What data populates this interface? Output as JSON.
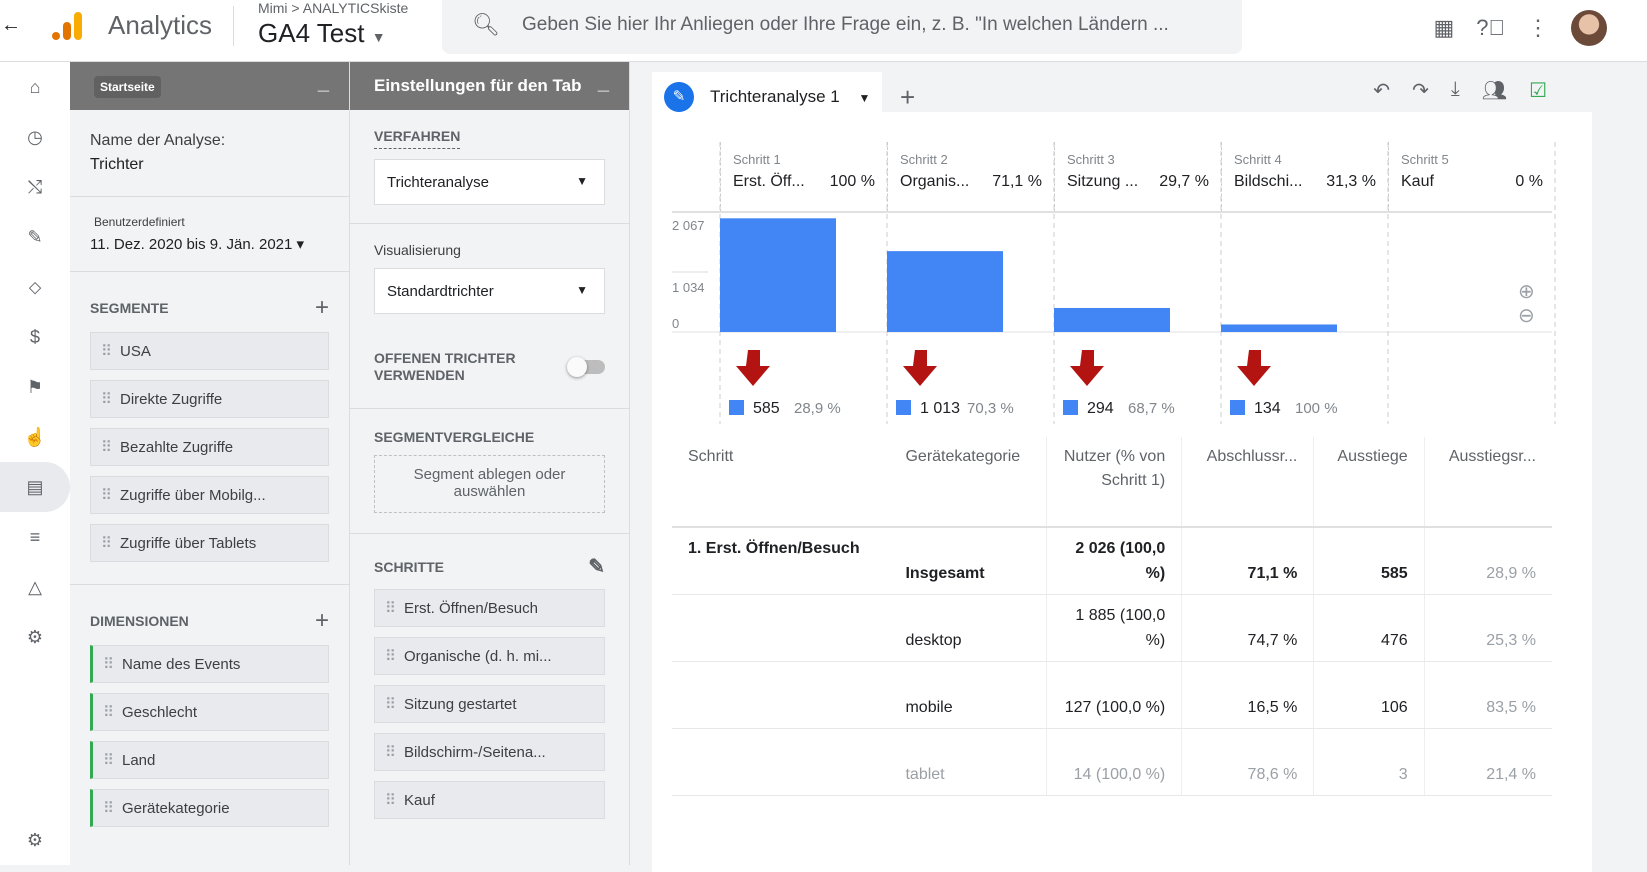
{
  "header": {
    "back": "←",
    "brand": "Analytics",
    "breadcrumb": "Mimi > ANALYTICSkiste",
    "property": "GA4 Test",
    "search_placeholder": "Geben Sie hier Ihr Anliegen oder Ihre Frage ein, z. B. \"In welchen Ländern ..."
  },
  "variables_panel": {
    "tooltip": "Startseite",
    "name_label": "Name der Analyse:",
    "name_value": "Trichter",
    "date_label": "Benutzerdefiniert",
    "date_range": "11. Dez. 2020 bis 9. Jän. 2021",
    "segments_label": "SEGMENTE",
    "segments": [
      "USA",
      "Direkte Zugriffe",
      "Bezahlte Zugriffe",
      "Zugriffe über Mobilg...",
      "Zugriffe über Tablets"
    ],
    "dimensions_label": "DIMENSIONEN",
    "dimensions": [
      "Name des Events",
      "Geschlecht",
      "Land",
      "Gerätekategorie"
    ]
  },
  "tab_settings": {
    "title": "Einstellungen für den Tab",
    "technique_label": "VERFAHREN",
    "technique": "Trichteranalyse",
    "viz_label": "Visualisierung",
    "viz": "Standardtrichter",
    "open_funnel_label": "OFFENEN TRICHTER VERWENDEN",
    "open_funnel": false,
    "segment_compare_label": "SEGMENTVERGLEICHE",
    "segment_drop": "Segment ablegen oder auswählen",
    "steps_label": "SCHRITTE",
    "steps": [
      "Erst. Öffnen/Besuch",
      "Organische (d. h. mi...",
      "Sitzung gestartet",
      "Bildschirm-/Seitena...",
      "Kauf"
    ]
  },
  "tab": {
    "label": "Trichteranalyse 1"
  },
  "chart_data": {
    "type": "bar",
    "y_ticks": [
      "2 067",
      "1 034",
      "0"
    ],
    "ylim": [
      0,
      2067
    ],
    "steps": [
      {
        "step": "Schritt 1",
        "name": "Erst. Öff...",
        "pct": "100 %",
        "value": 2026,
        "exits": "585",
        "exit_pct": "28,9 %"
      },
      {
        "step": "Schritt 2",
        "name": "Organis...",
        "pct": "71,1 %",
        "value": 1441,
        "exits": "1 013",
        "exit_pct": "70,3 %"
      },
      {
        "step": "Schritt 3",
        "name": "Sitzung ...",
        "pct": "29,7 %",
        "value": 428,
        "exits": "294",
        "exit_pct": "68,7 %"
      },
      {
        "step": "Schritt 4",
        "name": "Bildschi...",
        "pct": "31,3 %",
        "value": 134,
        "exits": "134",
        "exit_pct": "100 %"
      },
      {
        "step": "Schritt 5",
        "name": "Kauf",
        "pct": "0 %",
        "value": 0,
        "exits": "",
        "exit_pct": ""
      }
    ],
    "bar_color": "#4285f4",
    "arrow_color": "#b31412"
  },
  "table": {
    "headers": [
      "Schritt",
      "Gerätekategorie",
      "Nutzer (% von Schritt 1)",
      "Abschlussr...",
      "Ausstiege",
      "Ausstiegsr..."
    ],
    "rows": [
      [
        "1. Erst. Öffnen/Besuch",
        "Insgesamt",
        "2 026 (100,0 %)",
        "71,1 %",
        "585",
        "28,9 %"
      ],
      [
        "",
        "desktop",
        "1 885 (100,0 %)",
        "74,7 %",
        "476",
        "25,3 %"
      ],
      [
        "",
        "mobile",
        "127 (100,0 %)",
        "16,5 %",
        "106",
        "83,5 %"
      ],
      [
        "",
        "tablet",
        "14 (100,0 %)",
        "78,6 %",
        "3",
        "21,4 %"
      ]
    ]
  }
}
